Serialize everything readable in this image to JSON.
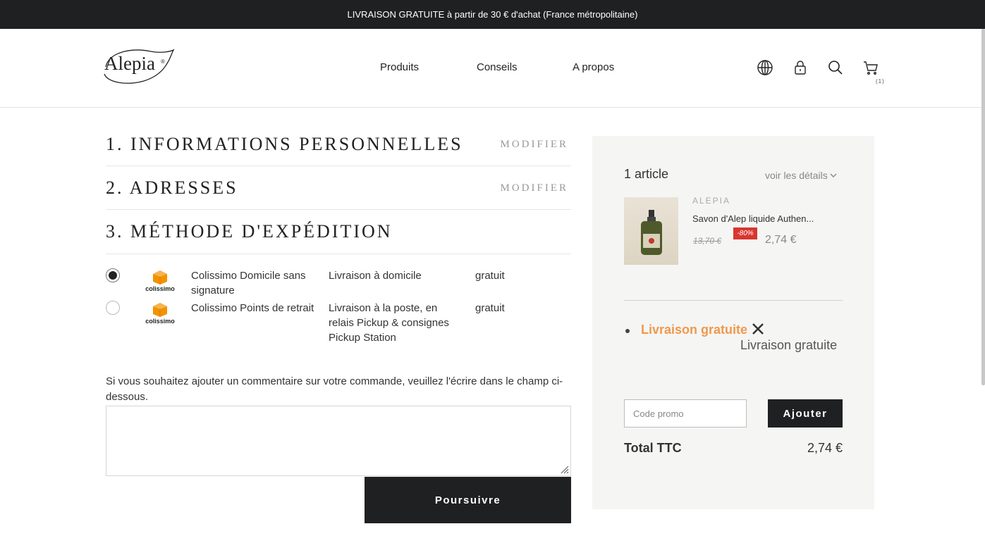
{
  "announcement": "LIVRAISON GRATUITE à partir de 30 € d'achat (France métropolitaine)",
  "logo": {
    "text": "Alepia",
    "registered": "®"
  },
  "nav": [
    "Produits",
    "Conseils",
    "A propos"
  ],
  "header_icons": [
    "globe-icon",
    "lock-icon",
    "search-icon",
    "cart-icon"
  ],
  "cart_count": "(1)",
  "steps": [
    {
      "title": "1. INFORMATIONS PERSONNELLES",
      "edit": "MODIFIER"
    },
    {
      "title": "2. ADRESSES",
      "edit": "MODIFIER"
    },
    {
      "title": "3. MÉTHODE D'EXPÉDITION"
    }
  ],
  "carriers": [
    {
      "selected": true,
      "logo_text": "colissimo",
      "name": "Colissimo Domicile sans signature",
      "description": "Livraison à domicile",
      "price": "gratuit"
    },
    {
      "selected": false,
      "logo_text": "colissimo",
      "name": "Colissimo Points de retrait",
      "description": "Livraison à la poste, en relais Pickup & consignes Pickup Station",
      "price": "gratuit"
    }
  ],
  "comment": {
    "label": "Si vous souhaitez ajouter un commentaire sur votre commande, veuillez l'écrire dans le champ ci-dessous.",
    "value": ""
  },
  "continue_label": "Poursuivre",
  "summary": {
    "count": "1 article",
    "details_link": "voir les détails",
    "product": {
      "brand": "ALEPIA",
      "name": "Savon d'Alep liquide Authen...",
      "old_price": "13,70 €",
      "discount": "-80%",
      "price": "2,74 €"
    },
    "shipping_link": "Livraison gratuite",
    "shipping_sub": "Livraison gratuite",
    "promo_placeholder": "Code promo",
    "promo_button": "Ajouter",
    "total_label": "Total TTC",
    "total_value": "2,74 €"
  },
  "colors": {
    "dark": "#1f2021",
    "accent_orange": "#f0984c",
    "discount_red": "#d8362f",
    "summary_bg": "#f5f5f4",
    "colissimo_orange": "#f39200"
  }
}
